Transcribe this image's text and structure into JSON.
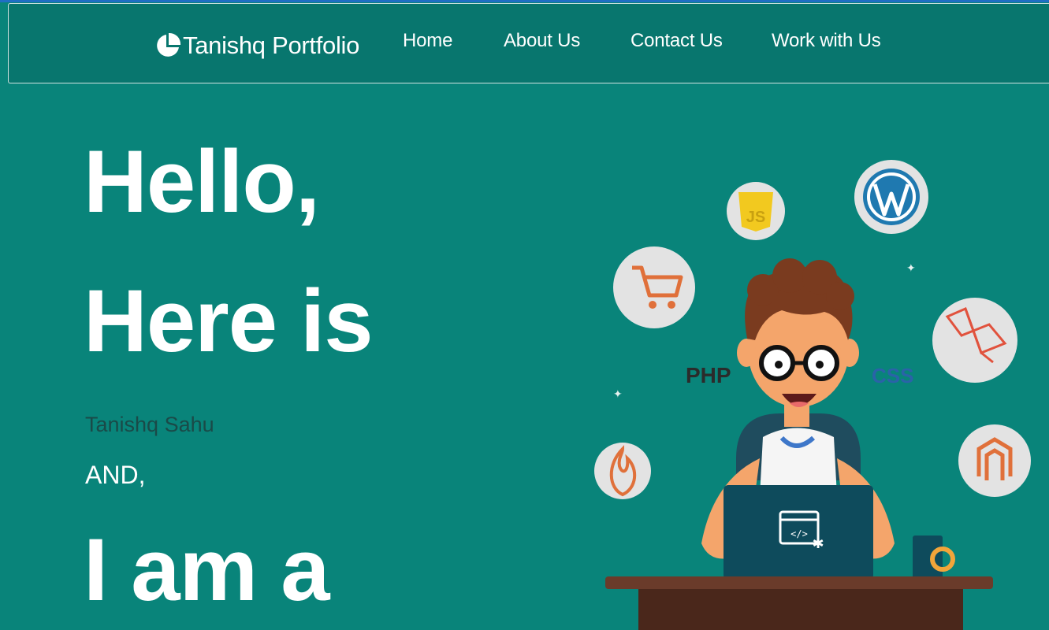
{
  "navbar": {
    "brand": "Tanishq Portfolio",
    "brand_icon": "pie-chart-icon",
    "items": [
      {
        "label": "Home"
      },
      {
        "label": "About Us"
      },
      {
        "label": "Contact Us"
      },
      {
        "label": "Work with Us"
      }
    ]
  },
  "hero": {
    "line1": "Hello,",
    "line2": "Here is",
    "name": "Tanishq Sahu",
    "conjunction": "AND,",
    "line3": "I am a"
  },
  "illustration": {
    "php_label": "PHP",
    "css_label": "CSS",
    "js_label": "JS",
    "code_label": "</>",
    "icons": [
      "cart-icon",
      "js-icon",
      "wordpress-icon",
      "laravel-icon",
      "codeigniter-icon",
      "magento-icon",
      "developer-character",
      "laptop-icon",
      "coffee-mug-icon"
    ]
  },
  "colors": {
    "background": "#09847a",
    "navbar": "#08766e",
    "text": "#ffffff",
    "name_text": "#1a4a48"
  }
}
